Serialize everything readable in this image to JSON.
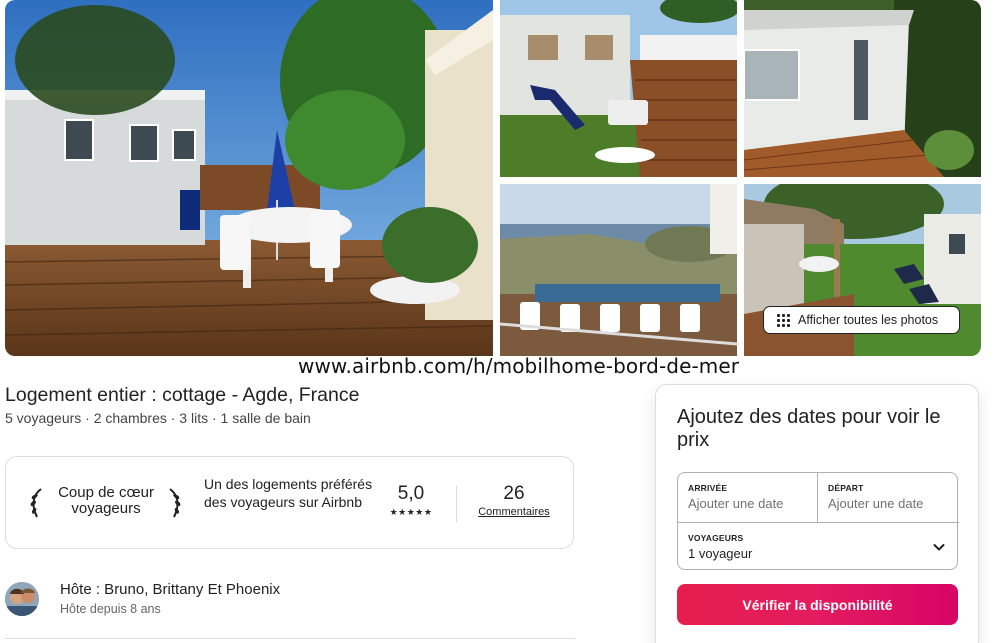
{
  "gallery": {
    "show_all_photos_label": "Afficher toutes les photos"
  },
  "watermark": "www.airbnb.com/h/mobilhome-bord-de-mer",
  "listing": {
    "title": "Logement entier : cottage - Agde, France",
    "subtitle": "5 voyageurs · 2 chambres · 3 lits · 1 salle de bain"
  },
  "guest_favorite": {
    "badge_label": "Coup de cœur voyageurs",
    "description": "Un des logements préférés des voyageurs sur Airbnb",
    "rating": "5,0",
    "stars": "★★★★★",
    "reviews_count": "26",
    "reviews_label": "Commentaires"
  },
  "host": {
    "name": "Hôte : Bruno, Brittany Et Phoenix",
    "since": "Hôte depuis 8 ans"
  },
  "booking": {
    "heading": "Ajoutez des dates pour voir le prix",
    "checkin_label": "ARRIVÉE",
    "checkin_placeholder": "Ajouter une date",
    "checkout_label": "DÉPART",
    "checkout_placeholder": "Ajouter une date",
    "guests_label": "VOYAGEURS",
    "guests_value": "1 voyageur",
    "check_button": "Vérifier la disponibilité"
  },
  "colors": {
    "brand": "#e31c5f",
    "text": "#222222",
    "muted": "#717171",
    "border": "#dddddd"
  },
  "icons": [
    "grid-icon",
    "laurel-left-icon",
    "laurel-right-icon",
    "star-icon",
    "chevron-down-icon"
  ]
}
